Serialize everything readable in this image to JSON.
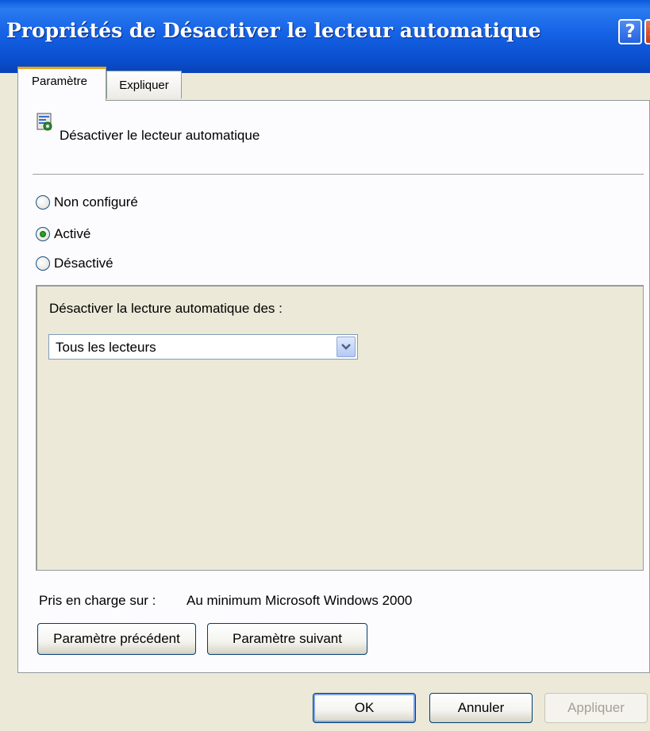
{
  "window": {
    "title": "Propriétés de Désactiver le lecteur automatique",
    "help_glyph": "?",
    "close_glyph": "✕"
  },
  "tabs": [
    {
      "label": "Paramètre",
      "active": true
    },
    {
      "label": "Expliquer",
      "active": false
    }
  ],
  "policy": {
    "name": "Désactiver le lecteur automatique",
    "icon": "policy-setting-icon"
  },
  "radios": [
    {
      "label": "Non configuré",
      "checked": false
    },
    {
      "label": "Activé",
      "checked": true
    },
    {
      "label": "Désactivé",
      "checked": false
    }
  ],
  "options": {
    "label": "Désactiver la lecture automatique des :",
    "dropdown_value": "Tous les lecteurs"
  },
  "supported": {
    "label": "Pris en charge sur :",
    "value": "Au minimum Microsoft Windows 2000"
  },
  "nav_buttons": {
    "previous": "Paramètre précédent",
    "next": "Paramètre suivant"
  },
  "dialog_buttons": {
    "ok": "OK",
    "cancel": "Annuler",
    "apply": "Appliquer"
  },
  "colors": {
    "titlebar": "#0a4fcf",
    "active_tab_accent": "#e8a41a",
    "dialog_bg": "#ece9d8",
    "radio_checked": "#21a121"
  }
}
